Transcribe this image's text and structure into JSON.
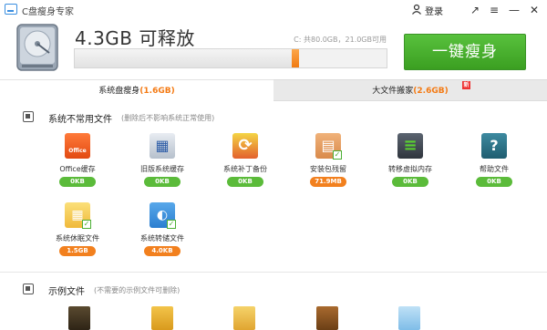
{
  "app": {
    "title": "C盘瘦身专家",
    "login_label": "登录"
  },
  "header": {
    "free_space": "4.3GB 可释放",
    "drive_info": "C: 共80.0GB，21.0GB可用",
    "slim_button": "一键瘦身",
    "used_fraction": 0.72
  },
  "tabs": [
    {
      "label": "系统盘瘦身",
      "size": "(1.6GB)",
      "active": true
    },
    {
      "label": "大文件搬家",
      "size": "(2.6GB)",
      "active": false,
      "badge": "新"
    }
  ],
  "sections": {
    "system": {
      "title": "系统不常用文件",
      "note": "(删除后不影响系统正常使用)",
      "items": [
        {
          "name": "Office缓存",
          "size": "0KB",
          "icon": "office-icon",
          "size_color": "#5bbb3a",
          "checked": false
        },
        {
          "name": "旧版系统缓存",
          "size": "0KB",
          "icon": "monitor-icon",
          "size_color": "#5bbb3a",
          "checked": false
        },
        {
          "name": "系统补丁备份",
          "size": "0KB",
          "icon": "windows-update-icon",
          "size_color": "#5bbb3a",
          "checked": false
        },
        {
          "name": "安装包残留",
          "size": "71.9MB",
          "icon": "package-icon",
          "size_color": "#f2801e",
          "checked": true
        },
        {
          "name": "转移虚拟内存",
          "size": "0KB",
          "icon": "memory-icon",
          "size_color": "#5bbb3a",
          "checked": false
        },
        {
          "name": "帮助文件",
          "size": "0KB",
          "icon": "help-icon",
          "size_color": "#5bbb3a",
          "checked": false
        },
        {
          "name": "系统休眠文件",
          "size": "1.5GB",
          "icon": "sleep-file-icon",
          "size_color": "#f2801e",
          "checked": true
        },
        {
          "name": "系统转储文件",
          "size": "4.0KB",
          "icon": "dump-file-icon",
          "size_color": "#f2801e",
          "checked": true
        }
      ]
    },
    "sample": {
      "title": "示例文件",
      "note": "(不需要的示例文件可删除)"
    }
  },
  "colors": {
    "accent_green": "#4caf35",
    "accent_orange": "#f47a13",
    "new_badge": "#e33333"
  }
}
